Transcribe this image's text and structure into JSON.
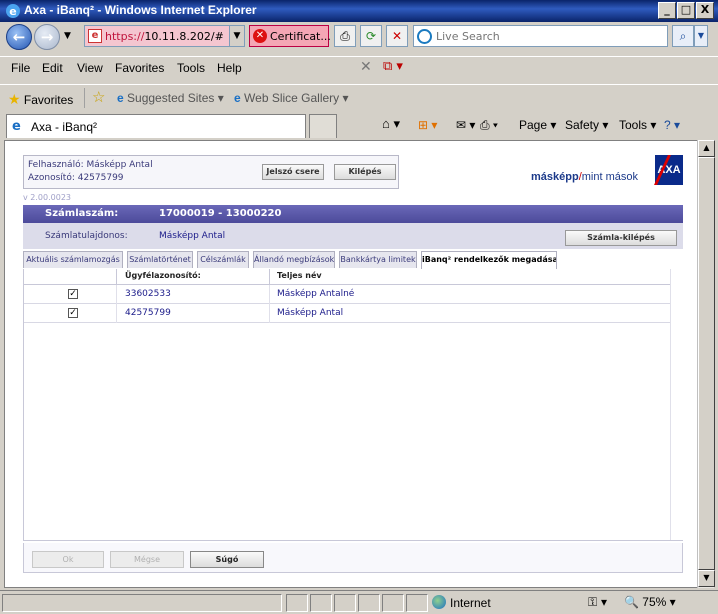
{
  "window": {
    "title": "Axa - iBanq² - Windows Internet Explorer",
    "minimize": "_",
    "maximize": "□",
    "close": "X"
  },
  "address": {
    "url_proto": "https://",
    "url_rest": "10.11.8.202/#",
    "cert_label": "Certificat...",
    "search_placeholder": "Live Search"
  },
  "menu": [
    "File",
    "Edit",
    "View",
    "Favorites",
    "Tools",
    "Help"
  ],
  "favorites": {
    "label": "Favorites",
    "suggested": "Suggested Sites ▾",
    "webslice": "Web Slice Gallery ▾"
  },
  "tab": {
    "title": "Axa - iBanq²"
  },
  "commands": {
    "page": "Page ▾",
    "safety": "Safety ▾",
    "tools": "Tools ▾"
  },
  "app": {
    "user_line": "Felhasználó: Másképp Antal",
    "id_line": "Azonosító: 42575799",
    "password_button": "Jelszó csere",
    "logout_button": "Kilépés",
    "version": "v 2.00.0023",
    "logo_text": "másképp",
    "logo_slash": "/",
    "logo_rest": "mint mások",
    "logo_brand": "AXA",
    "account_label": "Számlaszám:",
    "account_value": "17000019 - 13000220",
    "owner_label": "Számlatulajdonos:",
    "owner_value": "Másképp Antal",
    "account_logout_button": "Számla-kilépés",
    "tabs": [
      "Aktuális számlamozgás",
      "Számlatörténet",
      "Célszámlák",
      "Állandó megbízások",
      "Bankkártya limitek",
      "iBanq² rendelkezők megadása"
    ],
    "columns": [
      "Ügyfélazonosító:",
      "Teljes név"
    ],
    "rows": [
      {
        "checked": true,
        "id": "33602533",
        "name": "Másképp Antalné"
      },
      {
        "checked": true,
        "id": "42575799",
        "name": "Másképp Antal"
      }
    ],
    "buttons": {
      "ok": "Ok",
      "cancel": "Mégse",
      "help": "Súgó"
    }
  },
  "status": {
    "zone": "Internet",
    "zoom": "75%"
  }
}
